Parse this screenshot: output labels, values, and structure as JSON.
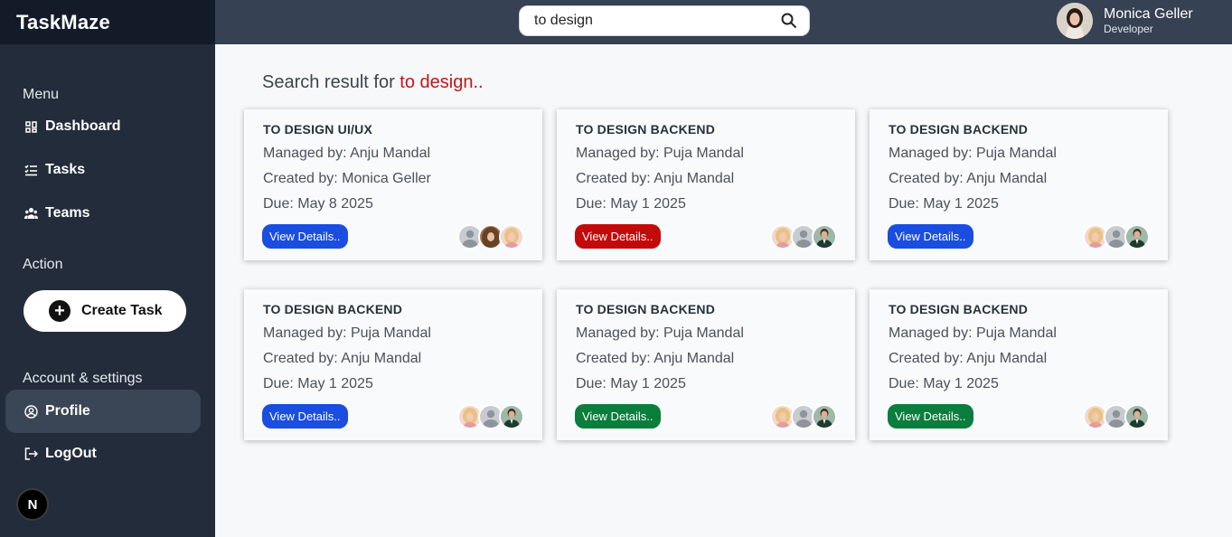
{
  "app": {
    "brand": "TaskMaze"
  },
  "sidebar": {
    "menu_label": "Menu",
    "items": [
      {
        "label": "Dashboard",
        "icon": "grid-icon"
      },
      {
        "label": "Tasks",
        "icon": "list-icon"
      },
      {
        "label": "Teams",
        "icon": "team-icon"
      }
    ],
    "action_label": "Action",
    "create_label": "Create Task",
    "account_label": "Account & settings",
    "profile_label": "Profile",
    "logout_label": "LogOut",
    "badge": "N"
  },
  "topbar": {
    "search_value": "to design",
    "user_name": "Monica Geller",
    "user_role": "Developer"
  },
  "main": {
    "heading_prefix": "Search result for",
    "heading_query": "to design.."
  },
  "cards": [
    {
      "title": "TO DESIGN UI/UX",
      "managed": "Managed by: Anju Mandal",
      "created": "Created by: Monica Geller",
      "due": "Due: May 8 2025",
      "button": "View Details..",
      "button_color": "#1a4de0",
      "avatars": [
        "grey",
        "curly",
        "blonde"
      ]
    },
    {
      "title": "TO DESIGN BACKEND",
      "managed": "Managed by: Puja Mandal",
      "created": "Created by: Anju Mandal",
      "due": "Due: May 1 2025",
      "button": "View Details..",
      "button_color": "#c30a0a",
      "avatars": [
        "blonde",
        "grey",
        "suit"
      ]
    },
    {
      "title": "TO DESIGN BACKEND",
      "managed": "Managed by: Puja Mandal",
      "created": "Created by: Anju Mandal",
      "due": "Due: May 1 2025",
      "button": "View Details..",
      "button_color": "#1a4de0",
      "avatars": [
        "blonde",
        "grey",
        "suit"
      ]
    },
    {
      "title": "TO DESIGN BACKEND",
      "managed": "Managed by: Puja Mandal",
      "created": "Created by: Anju Mandal",
      "due": "Due: May 1 2025",
      "button": "View Details..",
      "button_color": "#1a4de0",
      "avatars": [
        "blonde",
        "grey",
        "suit"
      ]
    },
    {
      "title": "TO DESIGN BACKEND",
      "managed": "Managed by: Puja Mandal",
      "created": "Created by: Anju Mandal",
      "due": "Due: May 1 2025",
      "button": "View Details..",
      "button_color": "#0b7d3c",
      "avatars": [
        "blonde",
        "grey",
        "suit"
      ]
    },
    {
      "title": "TO DESIGN BACKEND",
      "managed": "Managed by: Puja Mandal",
      "created": "Created by: Anju Mandal",
      "due": "Due: May 1 2025",
      "button": "View Details..",
      "button_color": "#0b7d3c",
      "avatars": [
        "blonde",
        "grey",
        "suit"
      ]
    }
  ]
}
